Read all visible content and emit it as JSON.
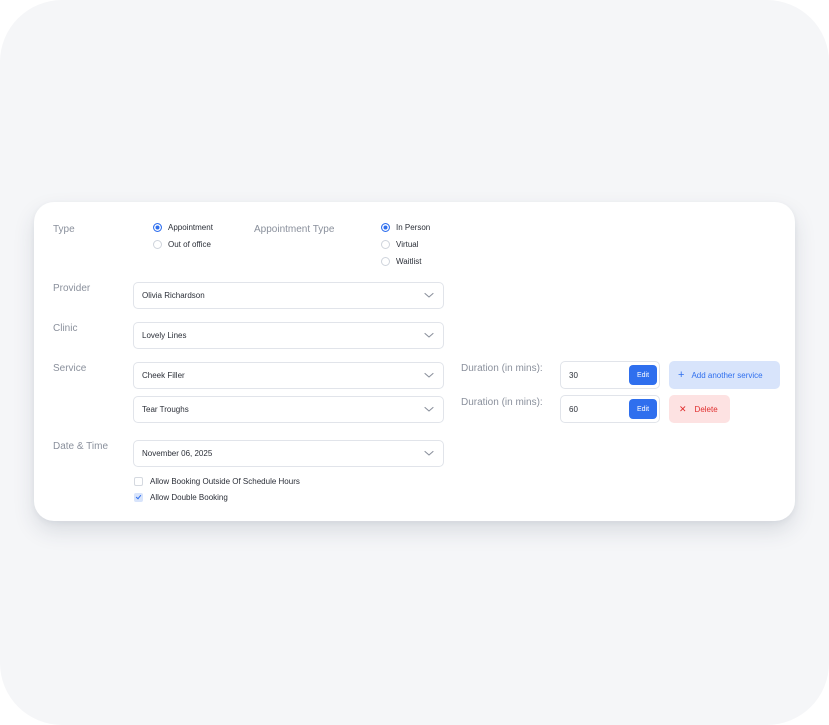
{
  "form": {
    "type": {
      "label": "Type",
      "options": [
        "Appointment",
        "Out of office"
      ],
      "selected": "Appointment"
    },
    "appointment_type": {
      "label": "Appointment Type",
      "options": [
        "In Person",
        "Virtual",
        "Waitlist"
      ],
      "selected": "In Person"
    },
    "provider": {
      "label": "Provider",
      "value": "Olivia Richardson"
    },
    "clinic": {
      "label": "Clinic",
      "value": "Lovely Lines"
    },
    "service": {
      "label": "Service",
      "rows": [
        {
          "value": "Cheek Filler",
          "duration_label": "Duration (in mins):",
          "duration": "30",
          "edit_label": "Edit"
        },
        {
          "value": "Tear Troughs",
          "duration_label": "Duration (in mins):",
          "duration": "60",
          "edit_label": "Edit"
        }
      ],
      "add_label": "Add another service",
      "delete_label": "Delete"
    },
    "datetime": {
      "label": "Date & Time",
      "value": "November 06, 2025"
    },
    "checkboxes": [
      {
        "label": "Allow Booking Outside Of Schedule Hours",
        "checked": false
      },
      {
        "label": "Allow Double Booking",
        "checked": true
      }
    ]
  },
  "colors": {
    "accent": "#2f6fee",
    "accent_soft": "#d8e4fb",
    "danger": "#e02d2d",
    "danger_soft": "#fde2e2",
    "label": "#8a909c",
    "text": "#2b2f38",
    "background": "#f5f6f8"
  },
  "icons": {
    "dropdown": "chevron-down-icon",
    "add": "plus-icon",
    "delete": "close-icon",
    "check": "check-icon"
  }
}
